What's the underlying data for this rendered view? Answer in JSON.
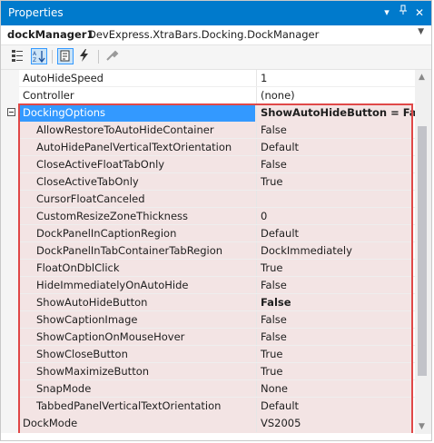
{
  "window": {
    "title": "Properties"
  },
  "object": {
    "name": "dockManager1",
    "type": "DevExpress.XtraBars.Docking.DockManager"
  },
  "toolbar": {
    "icons": [
      "categorized-icon",
      "alphabetical-icon",
      "properties-icon",
      "events-icon",
      "property-pages-icon"
    ]
  },
  "props": {
    "autohidespeed": {
      "name": "AutoHideSpeed",
      "value": "1"
    },
    "controller": {
      "name": "Controller",
      "value": "(none)"
    },
    "dockingoptions": {
      "name": "DockingOptions",
      "value": "ShowAutoHideButton = False"
    },
    "sub": [
      {
        "name": "AllowRestoreToAutoHideContainer",
        "value": "False"
      },
      {
        "name": "AutoHidePanelVerticalTextOrientation",
        "value": "Default"
      },
      {
        "name": "CloseActiveFloatTabOnly",
        "value": "False"
      },
      {
        "name": "CloseActiveTabOnly",
        "value": "True"
      },
      {
        "name": "CursorFloatCanceled",
        "value": ""
      },
      {
        "name": "CustomResizeZoneThickness",
        "value": "0"
      },
      {
        "name": "DockPanelInCaptionRegion",
        "value": "Default"
      },
      {
        "name": "DockPanelInTabContainerTabRegion",
        "value": "DockImmediately"
      },
      {
        "name": "FloatOnDblClick",
        "value": "True"
      },
      {
        "name": "HideImmediatelyOnAutoHide",
        "value": "False"
      },
      {
        "name": "ShowAutoHideButton",
        "value": "False"
      },
      {
        "name": "ShowCaptionImage",
        "value": "False"
      },
      {
        "name": "ShowCaptionOnMouseHover",
        "value": "False"
      },
      {
        "name": "ShowCloseButton",
        "value": "True"
      },
      {
        "name": "ShowMaximizeButton",
        "value": "True"
      },
      {
        "name": "SnapMode",
        "value": "None"
      },
      {
        "name": "TabbedPanelVerticalTextOrientation",
        "value": "Default"
      }
    ],
    "dockmode": {
      "name": "DockMode",
      "value": "VS2005"
    }
  },
  "colors": {
    "titlebar": "#007acc",
    "selection": "#3399ff",
    "highlight_border": "#e04848",
    "highlight_fill": "#f3e4e4"
  }
}
